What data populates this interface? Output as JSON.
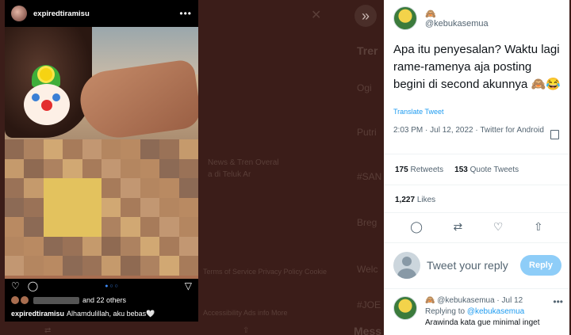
{
  "background": {
    "sidebar_heading_1": "Trer",
    "sidebar_trend_1": "Ogi",
    "sidebar_trend_2": "Putri",
    "sidebar_trend_3": "#SAN",
    "sidebar_trend_4": "Breg",
    "sidebar_trend_5": "Welc",
    "sidebar_trend_6": "#JOE",
    "sidebar_heading_2": "Mess",
    "news_snippet_1": "News & Tren Overal",
    "news_snippet_2": "a di Teluk Ar",
    "footer_snippet_1": "Terms of Service  Privacy Policy  Cookie",
    "footer_snippet_2": "Accessibility  Ads info  More",
    "expand_icon": "double-chevron-right",
    "close_icon": "close"
  },
  "instagram_post": {
    "username": "expiredtiramisu",
    "more_icon": "more-horizontal",
    "likes_suffix": "and 22 others",
    "caption_user": "expiredtiramisu",
    "caption_text": "Alhamdulillah, aku bebas🤍",
    "sticker": "clown-emoji",
    "colors": {
      "mosaic": [
        "#8f6a52",
        "#a77b5a",
        "#b98a62",
        "#c59a6c",
        "#d1a873",
        "#b48660",
        "#9a7257",
        "#ad8260",
        "#c29772",
        "#8c6a55"
      ]
    }
  },
  "tweet": {
    "emoji": "🙈",
    "handle": "@kebukasemua",
    "text": "Apa itu penyesalan? Waktu lagi rame-ramenya aja posting begini di second akunnya 🙈😂",
    "translate": "Translate Tweet",
    "meta": "2:03 PM · Jul 12, 2022 · Twitter for Android",
    "retweets_count": "175",
    "retweets_label": "Retweets",
    "quotes_count": "153",
    "quotes_label": "Quote Tweets",
    "likes_count": "1,227",
    "likes_label": "Likes",
    "action_icons": [
      "reply-icon",
      "retweet-icon",
      "like-icon",
      "share-icon"
    ],
    "reply_placeholder": "Tweet your reply",
    "reply_button": "Reply",
    "reply_author_line": "🙈 @kebukasemua · Jul 12",
    "reply_to_prefix": "Replying to",
    "reply_to_handle": "@kebukasemua",
    "reply_text": "Arawinda kata gue minimal inget",
    "colors": {
      "accent": "#1d9bf0",
      "reply_button_bg": "#8ecdf8"
    }
  }
}
